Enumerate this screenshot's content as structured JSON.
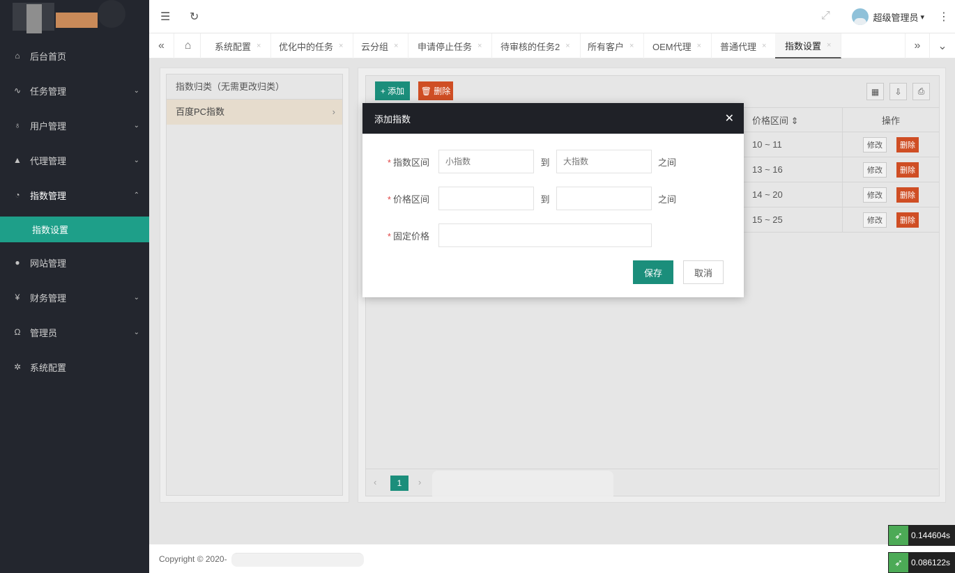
{
  "sidebar": {
    "items": [
      {
        "label": "后台首页",
        "icon": "home-icon",
        "glyph": "⌂"
      },
      {
        "label": "任务管理",
        "icon": "pulse-icon",
        "glyph": "∿",
        "chev": "⌄"
      },
      {
        "label": "用户管理",
        "icon": "users-icon",
        "glyph": "♁",
        "chev": "⌄"
      },
      {
        "label": "代理管理",
        "icon": "person-icon",
        "glyph": "▲",
        "chev": "⌄"
      },
      {
        "label": "指数管理",
        "icon": "gauge-icon",
        "glyph": "◔",
        "chev": "⌃"
      },
      {
        "label": "网站管理",
        "icon": "globe-icon",
        "glyph": "●"
      },
      {
        "label": "财务管理",
        "icon": "yen-icon",
        "glyph": "¥",
        "chev": "⌄"
      },
      {
        "label": "管理员",
        "icon": "admin-icon",
        "glyph": "Ω",
        "chev": "⌄"
      },
      {
        "label": "系统配置",
        "icon": "gear-icon",
        "glyph": "✲"
      }
    ],
    "active_sub": "指数设置"
  },
  "header": {
    "user_name": "超级管理员",
    "caret": "▾",
    "menu_glyph": "⋮",
    "fold_glyph": "☰",
    "refresh_glyph": "↻",
    "fullscreen_glyph": "⤢"
  },
  "tabs": {
    "prev_glyph": "«",
    "next_glyph": "»",
    "more_glyph": "⌄",
    "home_glyph": "⌂",
    "close_glyph": "×",
    "items": [
      "系统配置",
      "优化中的任务",
      "云分组",
      "申请停止任务",
      "待审核的任务2",
      "所有客户",
      "OEM代理",
      "普通代理",
      "指数设置"
    ]
  },
  "left_panel": {
    "header": "指数归类（无需更改归类）",
    "items": [
      "百度PC指数"
    ],
    "arrow": "›"
  },
  "toolbar": {
    "add_label": "+ 添加",
    "delete_label": "🗑 删除",
    "tool_icons": [
      "▦",
      "⇩",
      "⎙"
    ]
  },
  "table": {
    "headers": [
      "价格区间 ⇕",
      "操作"
    ],
    "rows": [
      {
        "range": "10 ~ 11",
        "edit": "修改",
        "del": "删除"
      },
      {
        "range": "13 ~ 16",
        "edit": "修改",
        "del": "删除"
      },
      {
        "range": "14 ~ 20",
        "edit": "修改",
        "del": "删除"
      },
      {
        "range": "15 ~ 25",
        "edit": "修改",
        "del": "删除"
      }
    ]
  },
  "pager": {
    "prev": "‹",
    "current": "1",
    "next": "›"
  },
  "footer": {
    "copyright": "Copyright © 2020-"
  },
  "timers": [
    "0.144604s",
    "0.086122s"
  ],
  "modal": {
    "title": "添加指数",
    "close": "✕",
    "required_mark": "*",
    "fields": {
      "index_range": {
        "label": "指数区间",
        "min_placeholder": "小指数",
        "max_placeholder": "大指数",
        "to": "到",
        "between": "之间"
      },
      "price_range": {
        "label": "价格区间",
        "to": "到",
        "between": "之间"
      },
      "fixed_price": {
        "label": "固定价格"
      }
    },
    "save": "保存",
    "cancel": "取消"
  },
  "colors": {
    "accent": "#1b8e7b",
    "danger": "#cf4e24",
    "sidebar": "#23262e",
    "modal_title": "#1f2127"
  }
}
